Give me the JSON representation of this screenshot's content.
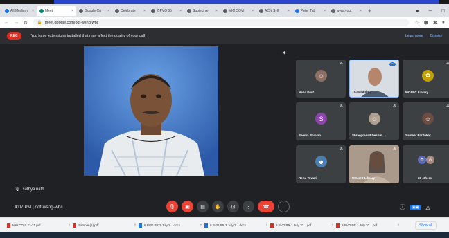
{
  "browser": {
    "tabs": [
      {
        "label": "All Medium",
        "color": "#1a73e8"
      },
      {
        "label": "Meet",
        "color": "#00897b",
        "active": true
      },
      {
        "label": "Google Cu",
        "color": "#5f6368"
      },
      {
        "label": "Celebrate",
        "color": "#5f6368"
      },
      {
        "label": "Z PVO 85",
        "color": "#5f6368"
      },
      {
        "label": "Subject re",
        "color": "#5f6368"
      },
      {
        "label": "MKI COVI",
        "color": "#5f6368"
      },
      {
        "label": "ACN Syll",
        "color": "#5f6368"
      },
      {
        "label": "Peter Tab",
        "color": "#1a73e8"
      },
      {
        "label": "www.yout",
        "color": "#5f6368"
      }
    ],
    "new_tab": "+",
    "url": "meet.google.com/odf-wsng-whc"
  },
  "banner": {
    "rec_label": "REC",
    "message": "You have extensions installed that may affect the quality of your call",
    "learn_more": "Learn more",
    "dismiss": "Dismiss"
  },
  "main": {
    "speaker_name": "sathya.nath"
  },
  "participants": [
    {
      "name": "Neha Dixit",
      "avatar": "photo"
    },
    {
      "name": "rs.ranjanhm",
      "avatar": "video"
    },
    {
      "name": "MCAEC Library",
      "avatar": "photo"
    },
    {
      "name": "Seema Bhavan",
      "avatar": "S"
    },
    {
      "name": "Shreeprasad Deshm...",
      "avatar": "photo"
    },
    {
      "name": "Sameer Pardekar",
      "avatar": "photo"
    },
    {
      "name": "Renu Tewari",
      "avatar": "photo"
    },
    {
      "name": "MCAEC Library",
      "avatar": "video"
    },
    {
      "name": "33 others",
      "avatar": "group"
    }
  ],
  "bottom": {
    "time": "4:07 PM",
    "meeting_code": "odf-wsng-whc"
  },
  "downloads": [
    {
      "label": "MKI COVI 21-21.pdf"
    },
    {
      "label": "Sample (1).pdf"
    },
    {
      "label": "8 PVO PR 3 July 2....docx"
    },
    {
      "label": "8 PVO PR 3 July 2....docx"
    },
    {
      "label": "8 PVO PR 1 July 20....pdf"
    },
    {
      "label": "8 PVO PR 1 July 20....pdf"
    }
  ],
  "show_all": "Show all",
  "colors": {
    "accent_red": "#ea4335",
    "blue": "#1a73e8",
    "tile_bg": "#3c4043"
  }
}
